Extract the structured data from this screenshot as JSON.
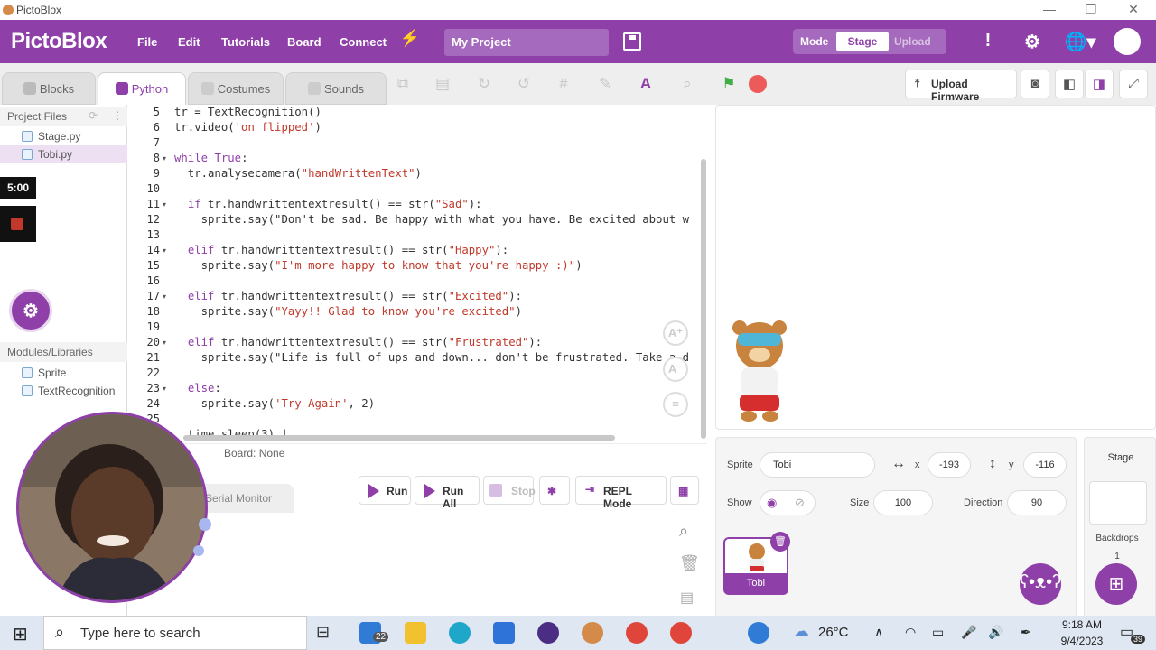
{
  "window": {
    "title": "PictoBlox",
    "minimize": "—",
    "restore": "❐",
    "close": "✕"
  },
  "menubar": {
    "logo": "PictoBlox",
    "items": [
      "File",
      "Edit",
      "Tutorials",
      "Board",
      "Connect"
    ],
    "project_name": "My Project",
    "mode_label": "Mode",
    "mode_stage": "Stage",
    "mode_upload": "Upload",
    "accent": "#8e3fa8"
  },
  "tabs": {
    "blocks": "Blocks",
    "python": "Python",
    "costumes": "Costumes",
    "sounds": "Sounds"
  },
  "toolbar": {
    "upload_firmware": "Upload Firmware"
  },
  "left": {
    "project_files": "Project Files",
    "files": [
      "Stage.py",
      "Tobi.py"
    ],
    "modules": "Modules/Libraries",
    "libs": [
      "Sprite",
      "TextRecognition"
    ],
    "timer": "5:00"
  },
  "editor": {
    "lines": [
      {
        "n": "5",
        "text": "tr = TextRecognition()"
      },
      {
        "n": "6",
        "text": "tr.video('on flipped')"
      },
      {
        "n": "7",
        "text": ""
      },
      {
        "n": "8",
        "text": "while True:"
      },
      {
        "n": "9",
        "text": "  tr.analysecamera(\"handWrittenText\")"
      },
      {
        "n": "10",
        "text": ""
      },
      {
        "n": "11",
        "text": "  if tr.handwrittentextresult() == str(\"Sad\"):"
      },
      {
        "n": "12",
        "text": "    sprite.say(\"Don't be sad. Be happy with what you have. Be excited about w"
      },
      {
        "n": "13",
        "text": ""
      },
      {
        "n": "14",
        "text": "  elif tr.handwrittentextresult() == str(\"Happy\"):"
      },
      {
        "n": "15",
        "text": "    sprite.say(\"I'm more happy to know that you're happy :)\")"
      },
      {
        "n": "16",
        "text": ""
      },
      {
        "n": "17",
        "text": "  elif tr.handwrittentextresult() == str(\"Excited\"):"
      },
      {
        "n": "18",
        "text": "    sprite.say(\"Yayy!! Glad to know you're excited\")"
      },
      {
        "n": "19",
        "text": ""
      },
      {
        "n": "20",
        "text": "  elif tr.handwrittentextresult() == str(\"Frustrated\"):"
      },
      {
        "n": "21",
        "text": "    sprite.say(\"Life is full of ups and down... don't be frustrated. Take a d"
      },
      {
        "n": "22",
        "text": ""
      },
      {
        "n": "23",
        "text": "  else:"
      },
      {
        "n": "24",
        "text": "    sprite.say('Try Again', 2)"
      },
      {
        "n": "25",
        "text": ""
      },
      {
        "n": "",
        "text": "  time.sleep(3) |"
      }
    ],
    "board_status": "Board: None"
  },
  "runbar": {
    "run": "Run",
    "run_all": "Run All",
    "stop": "Stop",
    "repl": "REPL Mode",
    "serial_monitor": "Serial Monitor"
  },
  "sprite": {
    "label": "Sprite",
    "name": "Tobi",
    "x_label": "x",
    "x": "-193",
    "y_label": "y",
    "y": "-116",
    "show_label": "Show",
    "size_label": "Size",
    "size": "100",
    "direction_label": "Direction",
    "direction": "90",
    "thumb_name": "Tobi"
  },
  "stagecol": {
    "title": "Stage",
    "backdrops": "Backdrops",
    "backdrop_count": "1"
  },
  "taskbar": {
    "search_placeholder": "Type here to search",
    "mail_badge": "22",
    "temp": "26°C",
    "time": "9:18 AM",
    "date": "9/4/2023",
    "notif": "39"
  }
}
